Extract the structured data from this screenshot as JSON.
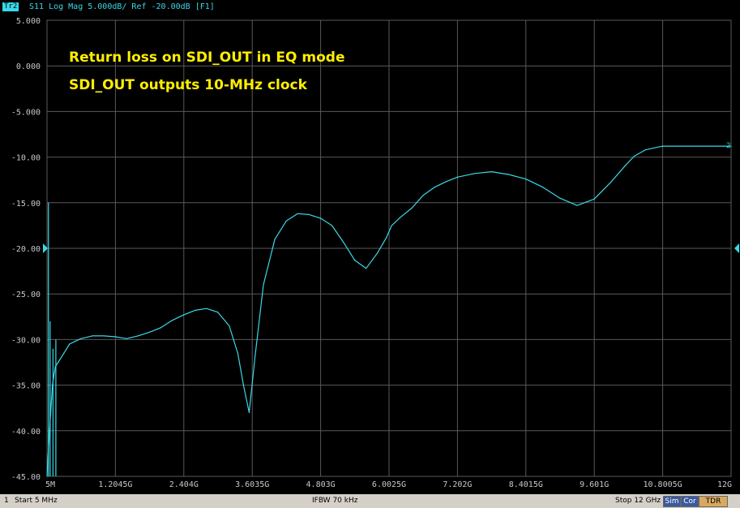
{
  "header": {
    "trace_badge": "Tr2",
    "trace_title": "S11 Log Mag 5.000dB/ Ref -20.00dB [F1]"
  },
  "status": {
    "channel": "1",
    "start": "Start 5 MHz",
    "ifbw": "IFBW 70 kHz",
    "stop": "Stop 12 GHz",
    "sim": "Sim",
    "cor": "Cor",
    "tdr": "TDR"
  },
  "colors": {
    "trace": "#3ad8e8",
    "annotation": "#ffee00",
    "grid": "#5a5a5a",
    "axis_text": "#c8c8c8"
  },
  "chart_data": {
    "type": "line",
    "title": "",
    "annotations": [
      "Return loss on SDI_OUT in EQ mode",
      "SDI_OUT outputs 10-MHz clock"
    ],
    "xlabel": "",
    "ylabel": "",
    "x_unit": "GHz",
    "xlim": [
      0.005,
      12
    ],
    "ylim": [
      -45,
      5
    ],
    "reference_level_db": -20,
    "grid": true,
    "trace_marker_label": "2",
    "y_ticks": [
      "5.000",
      "0.000",
      "-5.000",
      "-10.00",
      "-15.00",
      "-20.00",
      "-25.00",
      "-30.00",
      "-35.00",
      "-40.00",
      "-45.00"
    ],
    "y_tick_values": [
      5,
      0,
      -5,
      -10,
      -15,
      -20,
      -25,
      -30,
      -35,
      -40,
      -45
    ],
    "x_ticks": [
      "5M",
      "1.2045G",
      "2.404G",
      "3.6035G",
      "4.803G",
      "6.0025G",
      "7.202G",
      "8.4015G",
      "9.601G",
      "10.8005G",
      "12G"
    ],
    "x_tick_values": [
      0.005,
      1.2045,
      2.404,
      3.6035,
      4.803,
      6.0025,
      7.202,
      8.4015,
      9.601,
      10.8005,
      12
    ],
    "series": [
      {
        "x": [
          0.005,
          0.02,
          0.05,
          0.08,
          0.1,
          0.15,
          0.2,
          0.3,
          0.4,
          0.5,
          0.6,
          0.8,
          1.0,
          1.2,
          1.4,
          1.6,
          1.8,
          2.0,
          2.2,
          2.4,
          2.6,
          2.8,
          3.0,
          3.2,
          3.35,
          3.45,
          3.55,
          3.65,
          3.8,
          4.0,
          4.2,
          4.4,
          4.6,
          4.8,
          5.0,
          5.2,
          5.4,
          5.6,
          5.8,
          5.95,
          6.05,
          6.2,
          6.4,
          6.6,
          6.8,
          7.0,
          7.2,
          7.5,
          7.8,
          8.1,
          8.4,
          8.7,
          9.0,
          9.3,
          9.6,
          9.9,
          10.15,
          10.3,
          10.5,
          10.8,
          11.1,
          11.4,
          11.7,
          12.0
        ],
        "y": [
          -45,
          -43,
          -40,
          -37,
          -35,
          -33,
          -32.5,
          -31.5,
          -30.5,
          -30.2,
          -29.9,
          -29.6,
          -29.6,
          -29.7,
          -29.9,
          -29.6,
          -29.2,
          -28.7,
          -27.9,
          -27.3,
          -26.8,
          -26.6,
          -27,
          -28.5,
          -31.5,
          -35,
          -38,
          -32,
          -24,
          -19,
          -17,
          -16.2,
          -16.3,
          -16.7,
          -17.5,
          -19.3,
          -21.3,
          -22.2,
          -20.5,
          -18.9,
          -17.5,
          -16.6,
          -15.6,
          -14.2,
          -13.3,
          -12.7,
          -12.2,
          -11.8,
          -11.6,
          -11.9,
          -12.4,
          -13.3,
          -14.5,
          -15.3,
          -14.6,
          -12.7,
          -10.9,
          -9.9,
          -9.2,
          -8.8,
          -8.8,
          -8.8,
          -8.8,
          -8.8
        ]
      }
    ],
    "spikes": [
      {
        "x": 0.03,
        "y": -15
      },
      {
        "x": 0.06,
        "y": -28
      },
      {
        "x": 0.11,
        "y": -31
      },
      {
        "x": 0.16,
        "y": -30
      }
    ]
  }
}
